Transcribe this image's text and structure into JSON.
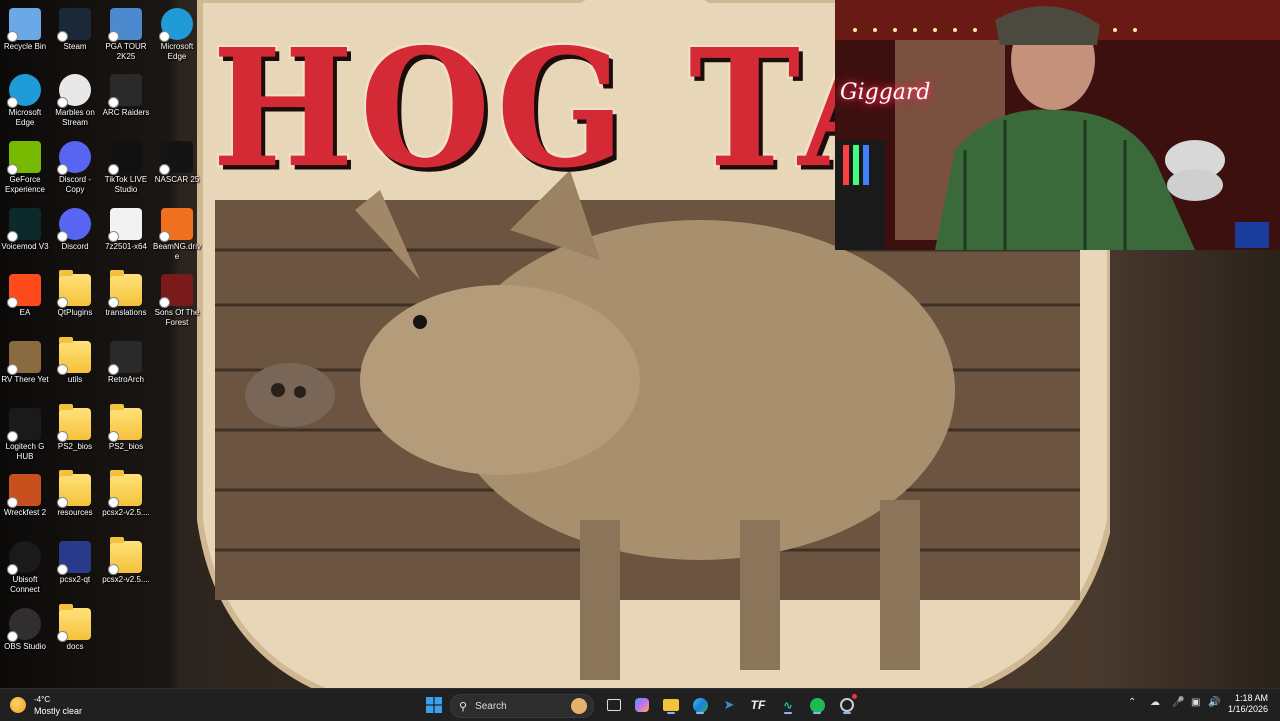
{
  "wallpaper": {
    "title": "HOG TAI"
  },
  "webcam": {
    "neon_sign": "Giggard"
  },
  "desktop": {
    "icons": [
      {
        "label": "Recycle Bin",
        "icon": "recycle-bin-icon",
        "color": "#6aa8e8"
      },
      {
        "label": "Steam",
        "icon": "steam-icon",
        "color": "#1b2838"
      },
      {
        "label": "PGA TOUR 2K25",
        "icon": "pga-tour-icon",
        "color": "#4c8ad0"
      },
      {
        "label": "Microsoft Edge",
        "icon": "edge-icon",
        "color": "#1f9bd8"
      },
      {
        "label": "Microsoft Edge",
        "icon": "edge-icon",
        "color": "#1f9bd8"
      },
      {
        "label": "Marbles on Stream",
        "icon": "marbles-icon",
        "color": "#e8e8e8"
      },
      {
        "label": "ARC Raiders",
        "icon": "arc-raiders-icon",
        "color": "#2a2a2a"
      },
      {
        "label": "GeForce Experience",
        "icon": "geforce-icon",
        "color": "#76b900"
      },
      {
        "label": "Discord - Copy",
        "icon": "discord-icon",
        "color": "#5865f2"
      },
      {
        "label": "TikTok LIVE Studio",
        "icon": "tiktok-icon",
        "color": "#111111"
      },
      {
        "label": "NASCAR 25",
        "icon": "nascar-icon",
        "color": "#141414"
      },
      {
        "label": "Voicemod V3",
        "icon": "voicemod-icon",
        "color": "#0c2a2c"
      },
      {
        "label": "Discord",
        "icon": "discord-icon",
        "color": "#5865f2"
      },
      {
        "label": "7z2501-x64",
        "icon": "7zip-icon",
        "color": "#f2f2f2"
      },
      {
        "label": "BeamNG.drive",
        "icon": "beamng-icon",
        "color": "#f07020"
      },
      {
        "label": "EA",
        "icon": "ea-icon",
        "color": "#ff4a1c"
      },
      {
        "label": "QtPlugins",
        "icon": "folder-icon",
        "color": "#f4c13a"
      },
      {
        "label": "translations",
        "icon": "folder-icon",
        "color": "#f4c13a"
      },
      {
        "label": "Sons Of The Forest",
        "icon": "sons-forest-icon",
        "color": "#7a1a1a"
      },
      {
        "label": "RV There Yet",
        "icon": "rv-there-yet-icon",
        "color": "#8a6a40"
      },
      {
        "label": "utils",
        "icon": "folder-icon",
        "color": "#f4c13a"
      },
      {
        "label": "RetroArch",
        "icon": "retroarch-icon",
        "color": "#2a2a2a"
      },
      {
        "label": "Logitech G HUB",
        "icon": "logitech-icon",
        "color": "#1a1a1a"
      },
      {
        "label": "PS2_bios",
        "icon": "folder-icon",
        "color": "#f4c13a"
      },
      {
        "label": "PS2_bios",
        "icon": "folder-icon",
        "color": "#f4c13a"
      },
      {
        "label": "Wreckfest 2",
        "icon": "wreckfest-icon",
        "color": "#c8501e"
      },
      {
        "label": "resources",
        "icon": "folder-icon",
        "color": "#f4c13a"
      },
      {
        "label": "pcsx2-v2.5....",
        "icon": "folder-icon",
        "color": "#f4c13a"
      },
      {
        "label": "Ubisoft Connect",
        "icon": "ubisoft-icon",
        "color": "#1a1a1a"
      },
      {
        "label": "pcsx2-qt",
        "icon": "pcsx2-icon",
        "color": "#2a3a8a"
      },
      {
        "label": "pcsx2-v2.5....",
        "icon": "folder-icon",
        "color": "#f4c13a"
      },
      {
        "label": "OBS Studio",
        "icon": "obs-icon",
        "color": "#302e31"
      },
      {
        "label": "docs",
        "icon": "folder-icon",
        "color": "#f4c13a"
      }
    ]
  },
  "taskbar": {
    "weather": {
      "temp": "-4°C",
      "condition": "Mostly clear",
      "icon": "weather-moon-icon"
    },
    "search_placeholder": "Search",
    "apps": [
      {
        "name": "start-button",
        "icon": "windows-icon",
        "color": "#3aa0f0"
      },
      {
        "name": "search-highlight",
        "icon": "search-highlight-icon",
        "color": "#e8b070"
      },
      {
        "name": "task-view",
        "icon": "task-view-icon",
        "color": "#dddddd"
      },
      {
        "name": "copilot",
        "icon": "copilot-icon",
        "color": "#c070f0"
      },
      {
        "name": "file-explorer",
        "icon": "folder-icon",
        "color": "#f4c13a"
      },
      {
        "name": "edge",
        "icon": "edge-icon",
        "color": "#1f9bd8"
      },
      {
        "name": "vscode-like",
        "icon": "app-icon",
        "color": "#3a8fd0"
      },
      {
        "name": "tf-app",
        "icon": "tf-icon",
        "color": "#eeeeee"
      },
      {
        "name": "voicemod",
        "icon": "voicemod-icon",
        "color": "#20c0a0"
      },
      {
        "name": "spotify",
        "icon": "spotify-icon",
        "color": "#1db954"
      },
      {
        "name": "obs",
        "icon": "obs-icon",
        "color": "#cccccc"
      }
    ],
    "clock": {
      "time": "1:18 AM",
      "date": "1/16/2026"
    }
  }
}
